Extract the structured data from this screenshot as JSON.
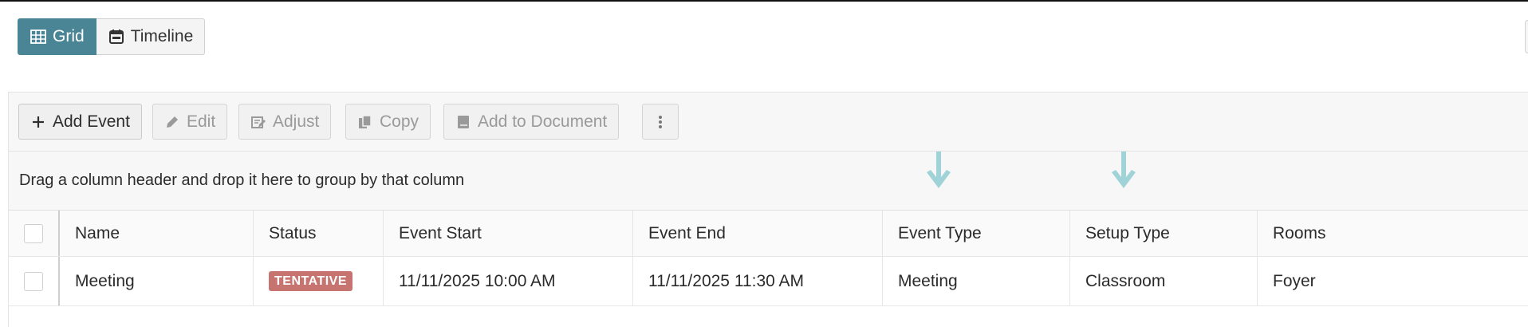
{
  "view_toggle": {
    "grid_label": "Grid",
    "timeline_label": "Timeline",
    "active": "grid"
  },
  "toolbar": {
    "add_event_label": "Add Event",
    "edit_label": "Edit",
    "adjust_label": "Adjust",
    "copy_label": "Copy",
    "add_to_document_label": "Add to Document"
  },
  "group_bar": {
    "hint": "Drag a column header and drop it here to group by that column"
  },
  "grid": {
    "columns": [
      "Name",
      "Status",
      "Event Start",
      "Event End",
      "Event Type",
      "Setup Type",
      "Rooms"
    ],
    "rows": [
      {
        "name": "Meeting",
        "status": "TENTATIVE",
        "event_start": "11/11/2025 10:00 AM",
        "event_end": "11/11/2025 11:30 AM",
        "event_type": "Meeting",
        "setup_type": "Classroom",
        "rooms": "Foyer"
      }
    ]
  },
  "colors": {
    "accent": "#4a8596",
    "status_tentative": "#c77470",
    "drop_arrow": "#9fd3d8"
  }
}
